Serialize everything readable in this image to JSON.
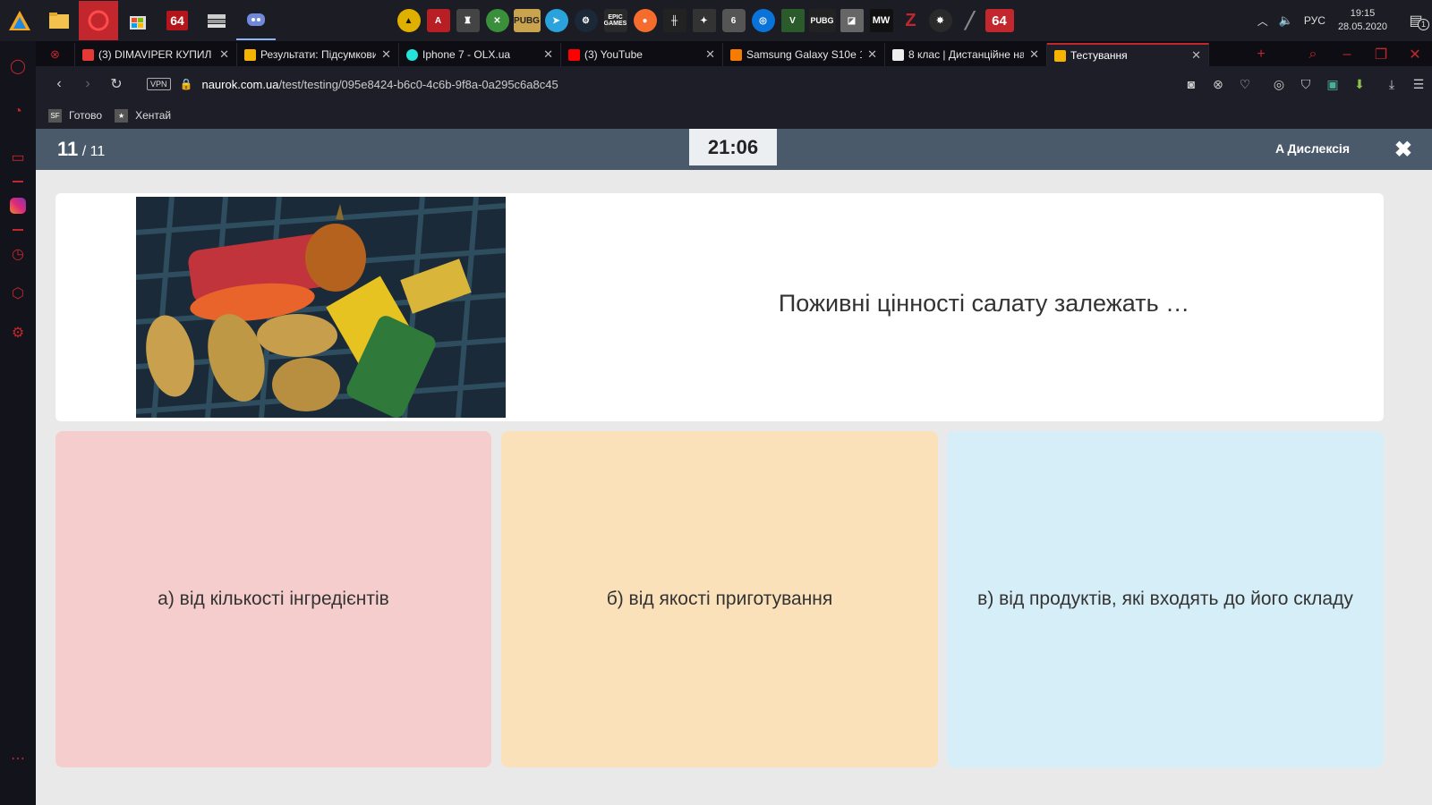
{
  "taskbar": {
    "pinned": [
      "64",
      "64"
    ],
    "tray_apps": [
      "EPIC\nGAMES",
      "PUBG",
      "PUBG",
      "MW",
      "64"
    ],
    "language": "РУС",
    "time": "19:15",
    "date": "28.05.2020",
    "notifications": "1"
  },
  "tabs": [
    {
      "title": "(3) DIMAVIPER КУПИЛ П",
      "favicon_color": "#e53935"
    },
    {
      "title": "Результати: Підсумкови",
      "favicon_color": "#f5b400"
    },
    {
      "title": "Iphone 7 - OLX.ua",
      "favicon_color": "#23e5db"
    },
    {
      "title": "(3) YouTube",
      "favicon_color": "#ff0000"
    },
    {
      "title": "Samsung Galaxy S10e 12",
      "favicon_color": "#f57c00"
    },
    {
      "title": "8 клас | Дистанційне на",
      "favicon_color": "#eeeeee"
    },
    {
      "title": "Тестування",
      "favicon_color": "#f5b400",
      "active": true
    }
  ],
  "address": {
    "vpn": "VPN",
    "url_host": "naurok.com.ua",
    "url_path": "/test/testing/095e8424-b6c0-4c6b-9f8a-0a295c6a8c45"
  },
  "bookmarks": [
    {
      "label": "Готово",
      "icon": "SF"
    },
    {
      "label": "Хентай",
      "icon": "★"
    }
  ],
  "quiz": {
    "current": "11",
    "total": "/ 11",
    "timer": "21:06",
    "dyslexia": "A Дислексія",
    "question": "Поживні цінності салату залежать …",
    "answers": [
      "а) від кількості інгредієнтів",
      "б) від якості приготування",
      "в) від продуктів, які входять до його складу"
    ],
    "answer_colors": [
      "#f6cdcd",
      "#fbe1b9",
      "#d6eef8"
    ]
  }
}
